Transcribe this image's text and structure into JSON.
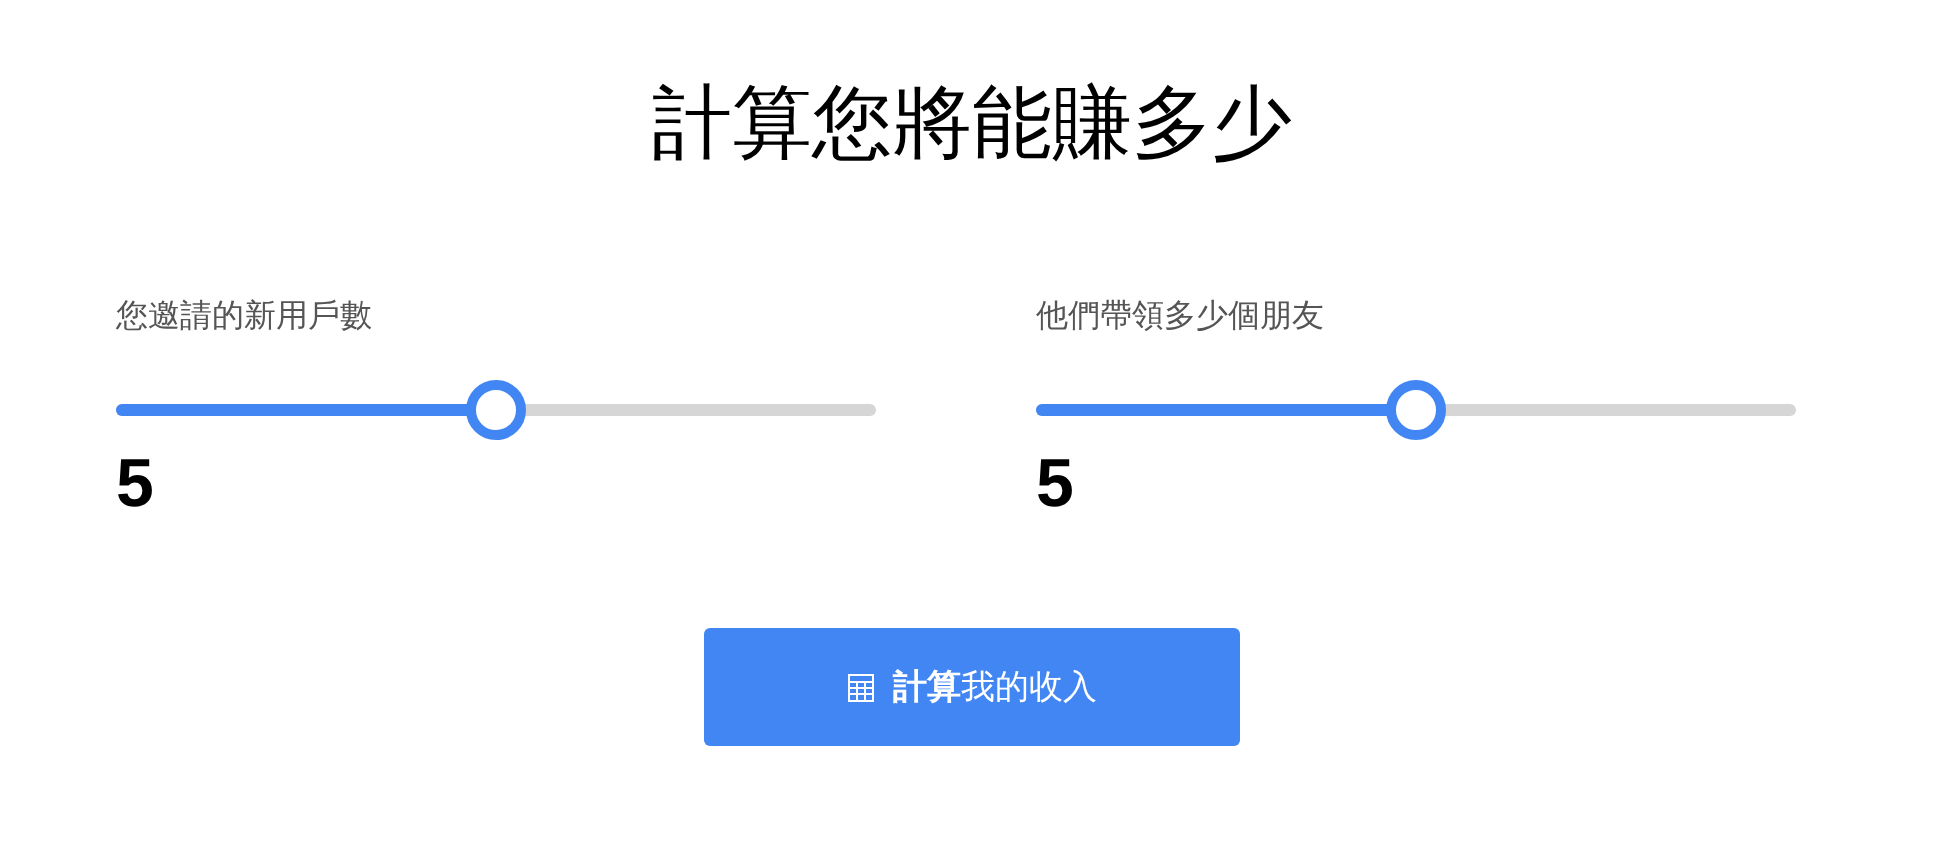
{
  "title": "計算您將能賺多少",
  "sliders": [
    {
      "label": "您邀請的新用戶數",
      "level": 0.5,
      "value": "5"
    },
    {
      "label": "他們帶領多少個朋友",
      "level": 0.5,
      "value": "5"
    }
  ],
  "button": {
    "label": "**計算**我的收入"
  }
}
